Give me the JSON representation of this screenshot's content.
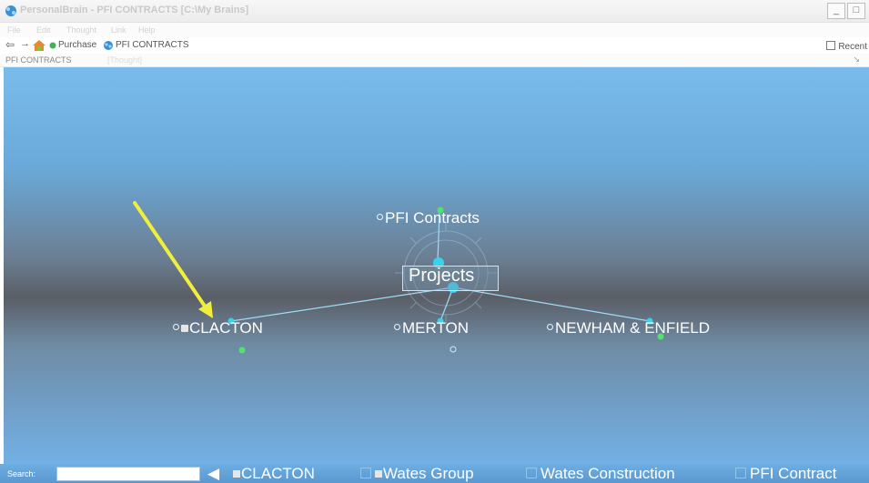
{
  "window": {
    "title": "PersonalBrain - PFI CONTRACTS [C:\\My Brains]",
    "controls": [
      "_",
      "□"
    ]
  },
  "menu": {
    "items": [
      "File",
      "Edit",
      "Thought",
      "Link",
      "Help"
    ]
  },
  "nav": {
    "back_symbol": "⇦",
    "forward_symbol": "→",
    "home_icon": "home-icon",
    "items": [
      {
        "label": "Purchase",
        "icon": "thought-dot-icon"
      },
      {
        "label": "PFI CONTRACTS",
        "icon": "brain-icon"
      }
    ],
    "recent_label": "Recent"
  },
  "breadcrumb": {
    "current": "PFI CONTRACTS",
    "faded": "[Thought]",
    "corner": "↘"
  },
  "plex": {
    "parent": "PFI Contracts",
    "active": "Projects",
    "children": [
      "CLACTON",
      "MERTON",
      "NEWHAM & ENFIELD"
    ],
    "colors": {
      "link": "#9fdcf5",
      "node_cyan": "#34d3f0",
      "node_green": "#4fe36a",
      "arrow": "#f2ee3c"
    }
  },
  "bottom": {
    "search_label": "Search:",
    "search_value": "",
    "history": [
      "CLACTON",
      "Wates Group",
      "Wates Construction",
      "PFI Contract"
    ]
  }
}
